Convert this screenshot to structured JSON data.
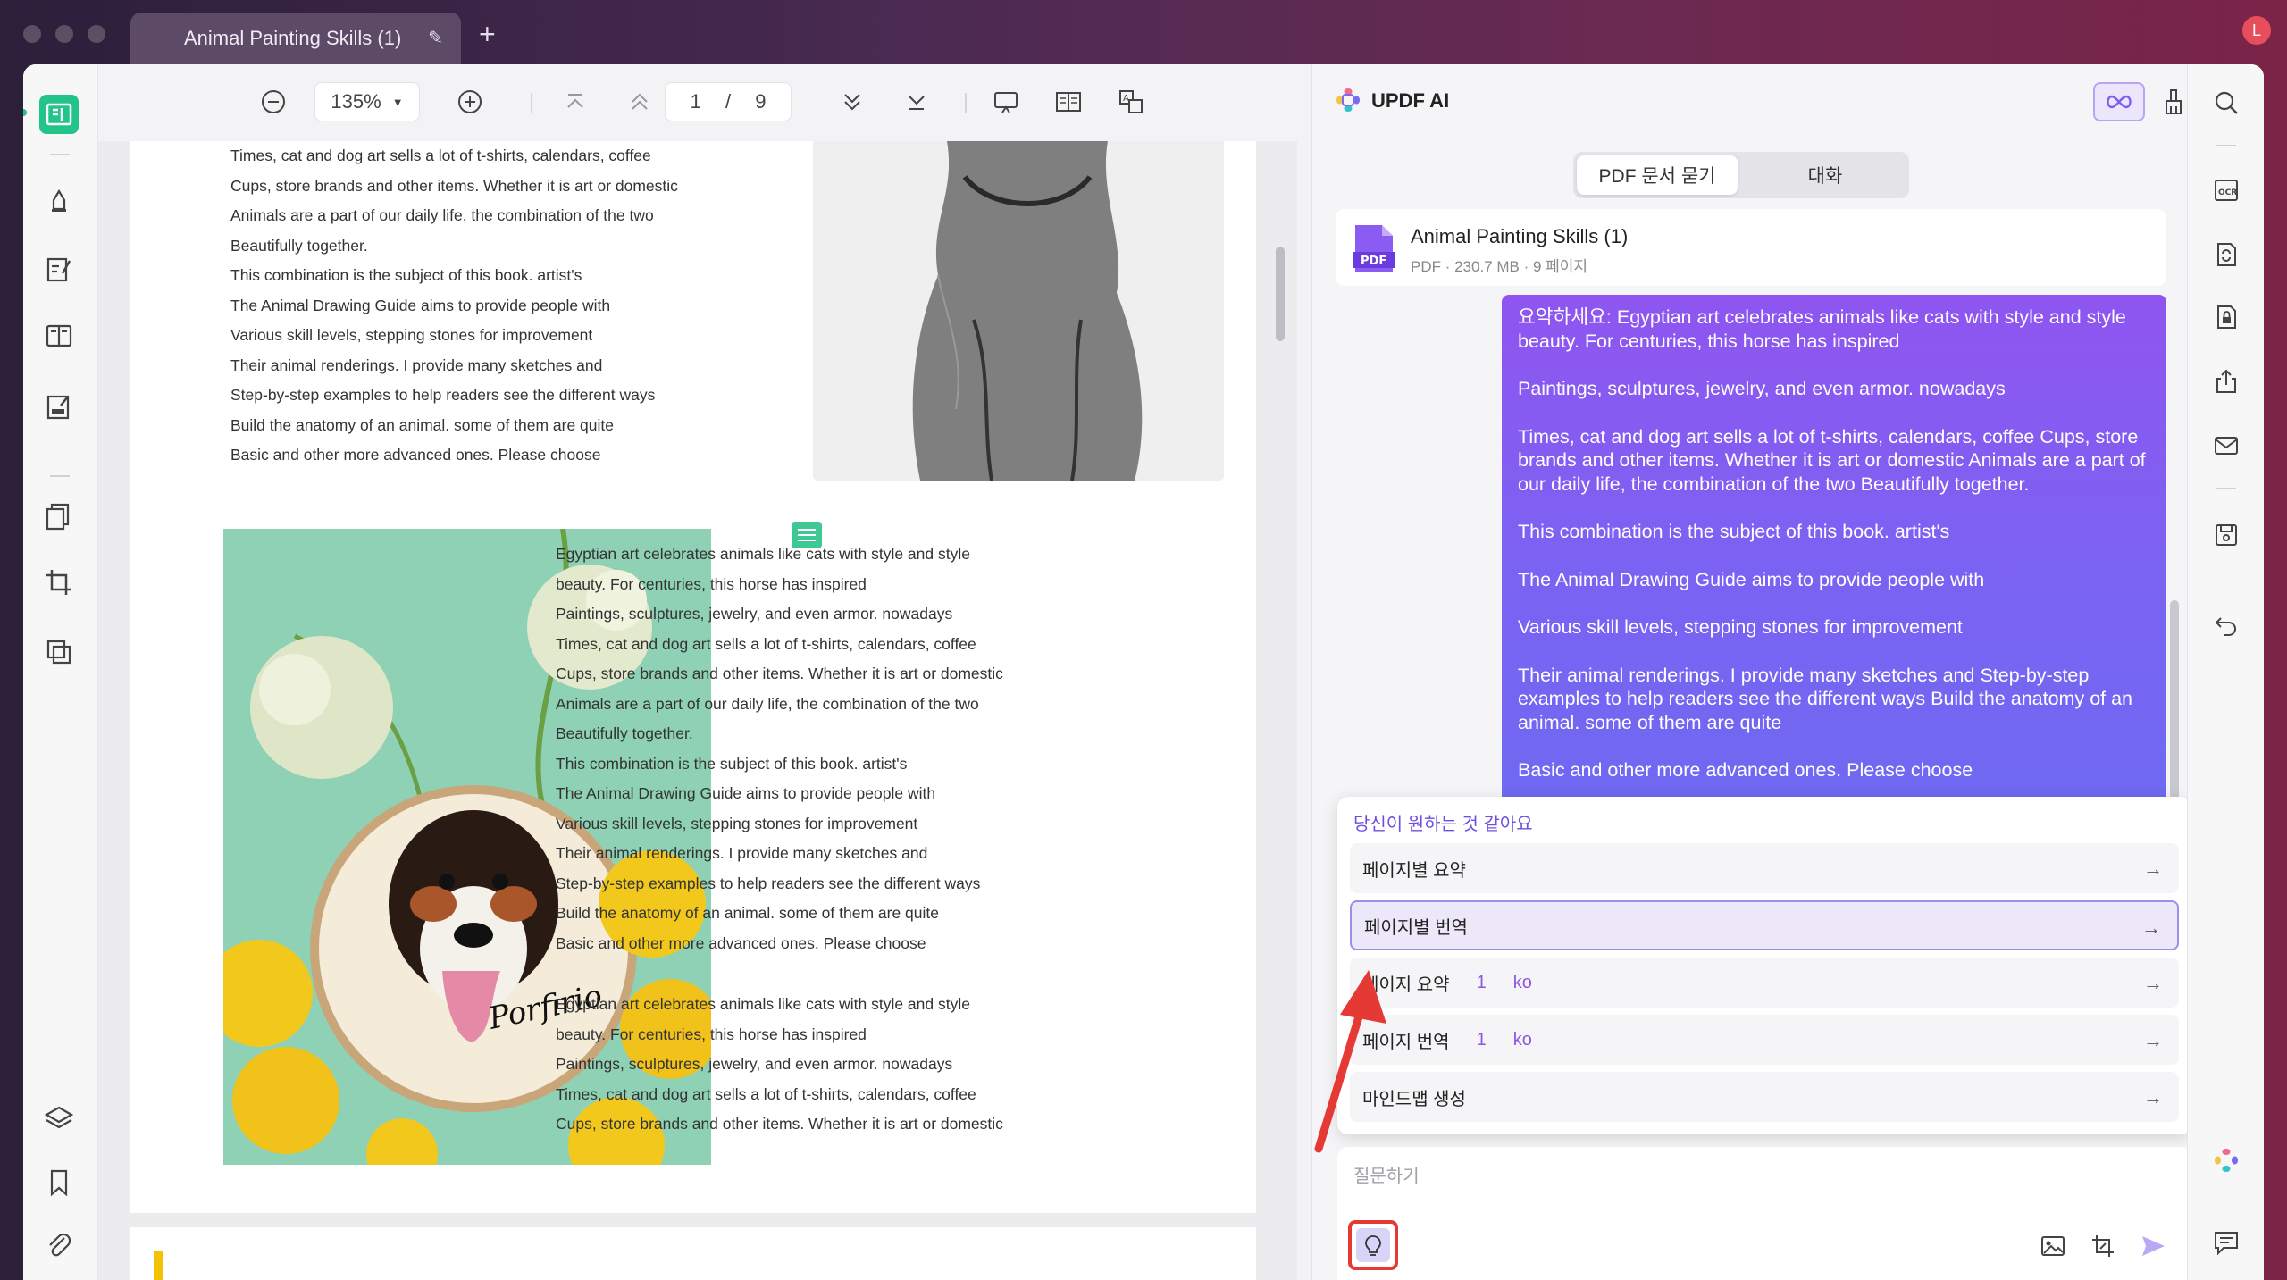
{
  "window": {
    "tab_title": "Animal Painting Skills (1)",
    "avatar_letter": "L"
  },
  "toolbar": {
    "zoom": "135%",
    "page_current": "1",
    "page_sep": "/",
    "page_total": "9"
  },
  "document": {
    "block_top": [
      "Times, cat and dog art sells a lot of t-shirts, calendars, coffee",
      "Cups, store brands and other items. Whether it is art or domestic",
      "Animals are a part of our daily life, the combination of the two",
      "Beautifully together.",
      "This combination is the subject of this book. artist's",
      "The Animal Drawing Guide aims to provide people with",
      "Various skill levels, stepping stones for improvement",
      "Their animal renderings. I provide many sketches and",
      "Step-by-step examples to help readers see the different ways",
      "Build the anatomy of an animal. some of them are quite",
      "Basic and other more advanced ones. Please choose"
    ],
    "block_middle": [
      "Egyptian art celebrates animals like cats with style and style",
      "beauty. For centuries, this horse has inspired",
      "Paintings, sculptures, jewelry, and even armor. nowadays",
      "Times, cat and dog art sells a lot of t-shirts, calendars, coffee",
      "Cups, store brands and other items. Whether it is art or domestic",
      "Animals are a part of our daily life, the combination of the two",
      "Beautifully together.",
      "This combination is the subject of this book. artist's",
      "The Animal Drawing Guide aims to provide people with",
      "Various skill levels, stepping stones for improvement",
      "Their animal renderings. I provide many sketches and",
      "Step-by-step examples to help readers see the different ways",
      "Build the anatomy of an animal. some of them are quite",
      "Basic and other more advanced ones. Please choose"
    ],
    "block_bottom": [
      "Egyptian art celebrates animals like cats with style and style",
      "beauty. For centuries, this horse has inspired",
      "Paintings, sculptures, jewelry, and even armor. nowadays",
      "Times, cat and dog art sells a lot of t-shirts, calendars, coffee",
      "Cups, store brands and other items. Whether it is art or domestic"
    ],
    "embroidery_text": "Porfirio"
  },
  "ai_panel": {
    "title": "UPDF AI",
    "tabs": [
      "PDF 문서 묻기",
      "대화"
    ],
    "file": {
      "name": "Animal Painting Skills (1)",
      "meta": "PDF · 230.7 MB · 9 페이지",
      "icon_label": "PDF"
    },
    "message": [
      "요약하세요: Egyptian art celebrates animals like cats with style and style beauty. For centuries, this horse has inspired",
      "Paintings, sculptures, jewelry, and even armor. nowadays",
      "Times, cat and dog art sells a lot of t-shirts, calendars, coffee Cups, store brands and other items. Whether it is art or domestic Animals are a part of our daily life, the combination of the two Beautifully together.",
      "This combination is the subject of this book. artist's",
      "The Animal Drawing Guide aims to provide people with",
      "Various skill levels, stepping stones for improvement",
      "Their animal renderings. I provide many sketches and Step-by-step examples to help readers see the different ways Build the anatomy of an animal. some of them are quite",
      "Basic and other more advanced ones. Please choose"
    ],
    "suggestions": {
      "title": "당신이 원하는 것 같아요",
      "items": [
        {
          "label": "페이지별 요약",
          "page": "",
          "lang": ""
        },
        {
          "label": "페이지별 번역",
          "page": "",
          "lang": ""
        },
        {
          "label": "페이지 요약",
          "page": "1",
          "lang": "ko"
        },
        {
          "label": "페이지 번역",
          "page": "1",
          "lang": "ko"
        },
        {
          "label": "마인드맵 생성",
          "page": "",
          "lang": ""
        }
      ],
      "arrow": "→"
    },
    "input": {
      "placeholder": "질문하기"
    }
  },
  "colors": {
    "accent": "#22c48a",
    "ai_purple": "#8b55e6",
    "highlight_red": "#e53935"
  }
}
